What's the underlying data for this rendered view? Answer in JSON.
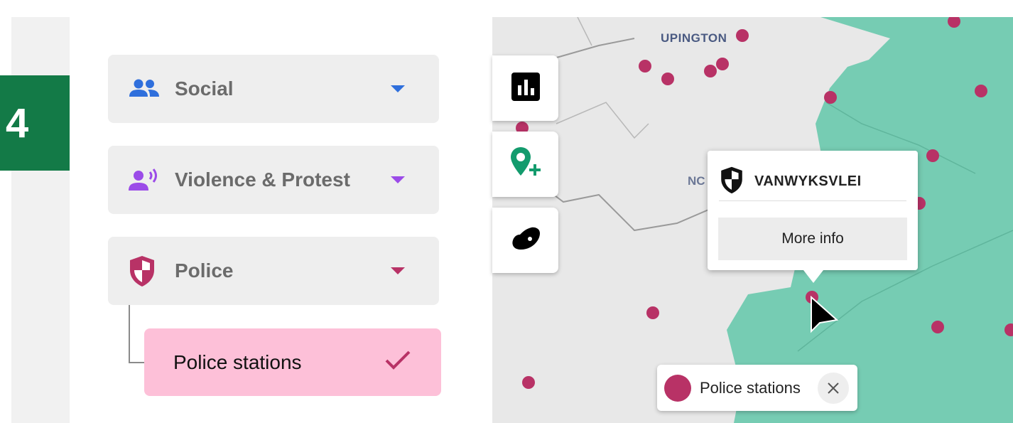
{
  "step_number": "4",
  "categories": [
    {
      "label": "Social",
      "icon": "people-icon",
      "color": "#2f6fdc"
    },
    {
      "label": "Violence & Protest",
      "icon": "megaphone-person-icon",
      "color": "#9b4be8"
    },
    {
      "label": "Police",
      "icon": "police-shield-icon",
      "color": "#b83266"
    }
  ],
  "sub_item": {
    "label": "Police stations",
    "selected": true,
    "bg": "#fdc0d8"
  },
  "map": {
    "town_label": "UPINGTON",
    "partial_label": "NC",
    "region_color": "#76ccb3",
    "dot_color": "#b83266"
  },
  "toolbar": [
    "chart-icon",
    "add-location-icon",
    "south-africa-map-icon"
  ],
  "popup": {
    "title": "VANWYKSVLEI",
    "button": "More info"
  },
  "legend": {
    "label": "Police stations"
  }
}
